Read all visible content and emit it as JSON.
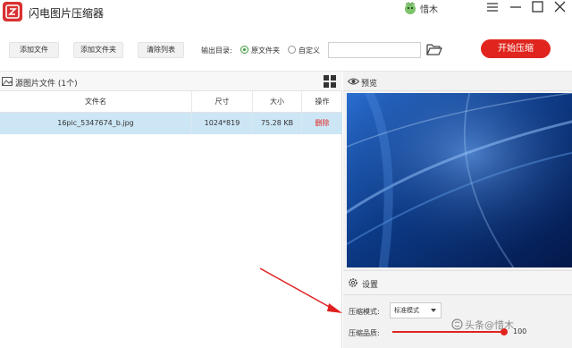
{
  "app": {
    "title": "闪电图片压缩器"
  },
  "user": {
    "name": "惜木"
  },
  "toolbar": {
    "add_file": "添加文件",
    "add_folder": "添加文件夹",
    "clear_list": "清除列表",
    "output_label": "输出目录:",
    "option_original": "原文件夹",
    "option_custom": "自定义",
    "selected_option": "原文件夹",
    "path_value": "",
    "start": "开始压缩"
  },
  "file_list": {
    "title": "源图片文件 (1个)",
    "columns": [
      "文件名",
      "尺寸",
      "大小",
      "操作"
    ],
    "rows": [
      {
        "name": "16pic_5347674_b.jpg",
        "dimensions": "1024*819",
        "size": "75.28 KB",
        "action": "删除"
      }
    ]
  },
  "preview": {
    "title": "预览"
  },
  "settings": {
    "title": "设置",
    "mode_label": "压缩模式:",
    "mode_value": "标准模式",
    "quality_label": "压缩品质:",
    "quality_value": "100"
  },
  "watermark": "头条@惜木",
  "colors": {
    "accent": "#e0251e",
    "selection": "#cce6f5",
    "radio": "#3a9b3a"
  },
  "icons": [
    "app-logo-icon",
    "avatar-icon",
    "menu-icon",
    "minimize-icon",
    "maximize-icon",
    "close-icon",
    "folder-icon",
    "image-icon",
    "grid-view-icon",
    "eye-icon",
    "gear-icon"
  ]
}
